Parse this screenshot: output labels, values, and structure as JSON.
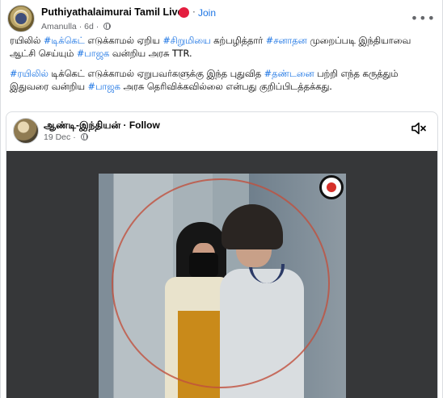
{
  "post": {
    "page_name": "Puthiyathalaimurai Tamil Live",
    "separator": "·",
    "join_label": "Join",
    "author": "Amanulla",
    "age": "6d",
    "more_icon": "more-horizontal-icon",
    "paragraph1": {
      "t1": "ரயிலில் ",
      "tag1": "#டிக்கெட்",
      "t2": " எடுக்காமல் ஏறிய ",
      "tag2": "#சிறுமியை",
      "t3": " கற்பழித்தார் ",
      "tag3": "#சனாதன",
      "t4": " முறைப்படி இந்தியாவை ஆட்சி செய்யும் ",
      "tag4": "#பாஜக",
      "t5": " வன்றிய அரசு TTR."
    },
    "paragraph2": {
      "tag1": "#ரயிலில்",
      "t1": " டிக்கெட் எடுக்காமல் ஏறுபவர்களுக்கு இந்த புதுவித ",
      "tag2": "#தண்டனை",
      "t2": " பற்றி எந்த கருத்தும் இதுவரை வன்றிய ",
      "tag3": "#பாஜக",
      "t3": " அரசு தெரிவிக்கவில்லை என்பது குறிப்பிடத்தக்கது."
    }
  },
  "shared": {
    "name": "ஆண்டி-இந்தியன்",
    "separator": "·",
    "follow_label": "Follow",
    "date": "19 Dec",
    "mute_icon": "volume-mute-icon"
  },
  "colors": {
    "link": "#1b74e4",
    "badge_red": "#e41e3f",
    "video_bg": "#363739"
  }
}
